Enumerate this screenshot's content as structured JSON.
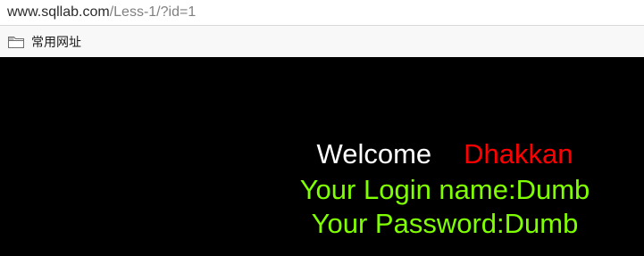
{
  "address_bar": {
    "url_host": "www.sqllab.com",
    "url_path": "/Less-1/?id=1"
  },
  "bookmarks_bar": {
    "items": [
      {
        "label": "常用网址",
        "icon": "folder-icon"
      }
    ]
  },
  "page": {
    "welcome_label": "Welcome",
    "greeting_name": "Dhakkan",
    "login_name_line": "Your Login name:Dumb",
    "password_line": "Your Password:Dumb"
  },
  "colors": {
    "page_background": "#000000",
    "welcome": "#FFFFFF",
    "greeting_name": "#FF0000",
    "result_text": "#80FF00",
    "url_host": "#2A2A2A",
    "url_path": "#808080"
  }
}
